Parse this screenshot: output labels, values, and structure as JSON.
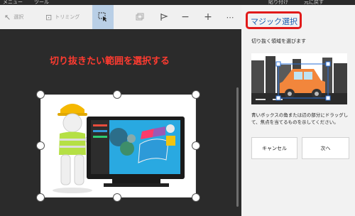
{
  "menu": {
    "left": "メニュー",
    "tools": "ツール",
    "paste": "貼り付け",
    "right_cut": "元に戻す"
  },
  "toolbar": {
    "select_label": "選択",
    "trim_label": "トリミング",
    "items": [
      {
        "name": "magic-select-button",
        "icon": "magic-select-icon"
      },
      {
        "name": "effects-button",
        "icon": "effects-icon"
      },
      {
        "name": "flag-button",
        "icon": "flag-icon"
      },
      {
        "name": "zoom-out-button",
        "icon": "minus-icon"
      },
      {
        "name": "zoom-in-button",
        "icon": "plus-icon"
      },
      {
        "name": "more-button",
        "icon": "more-icon"
      }
    ]
  },
  "canvas": {
    "title": "切り抜きたい範囲を選択する"
  },
  "pane": {
    "title": "マジック選択",
    "subtitle": "切り抜く領域を選びます",
    "description": "青いボックスの角または辺の部分にドラッグして、焦点を当てるものを示してください。",
    "cancel_label": "キャンセル",
    "next_label": "次へ"
  },
  "colors": {
    "accent": "#1f5fb0",
    "highlight": "#e11a1a",
    "canvas_bg": "#2b2b2b",
    "title_text": "#ff3b30"
  }
}
